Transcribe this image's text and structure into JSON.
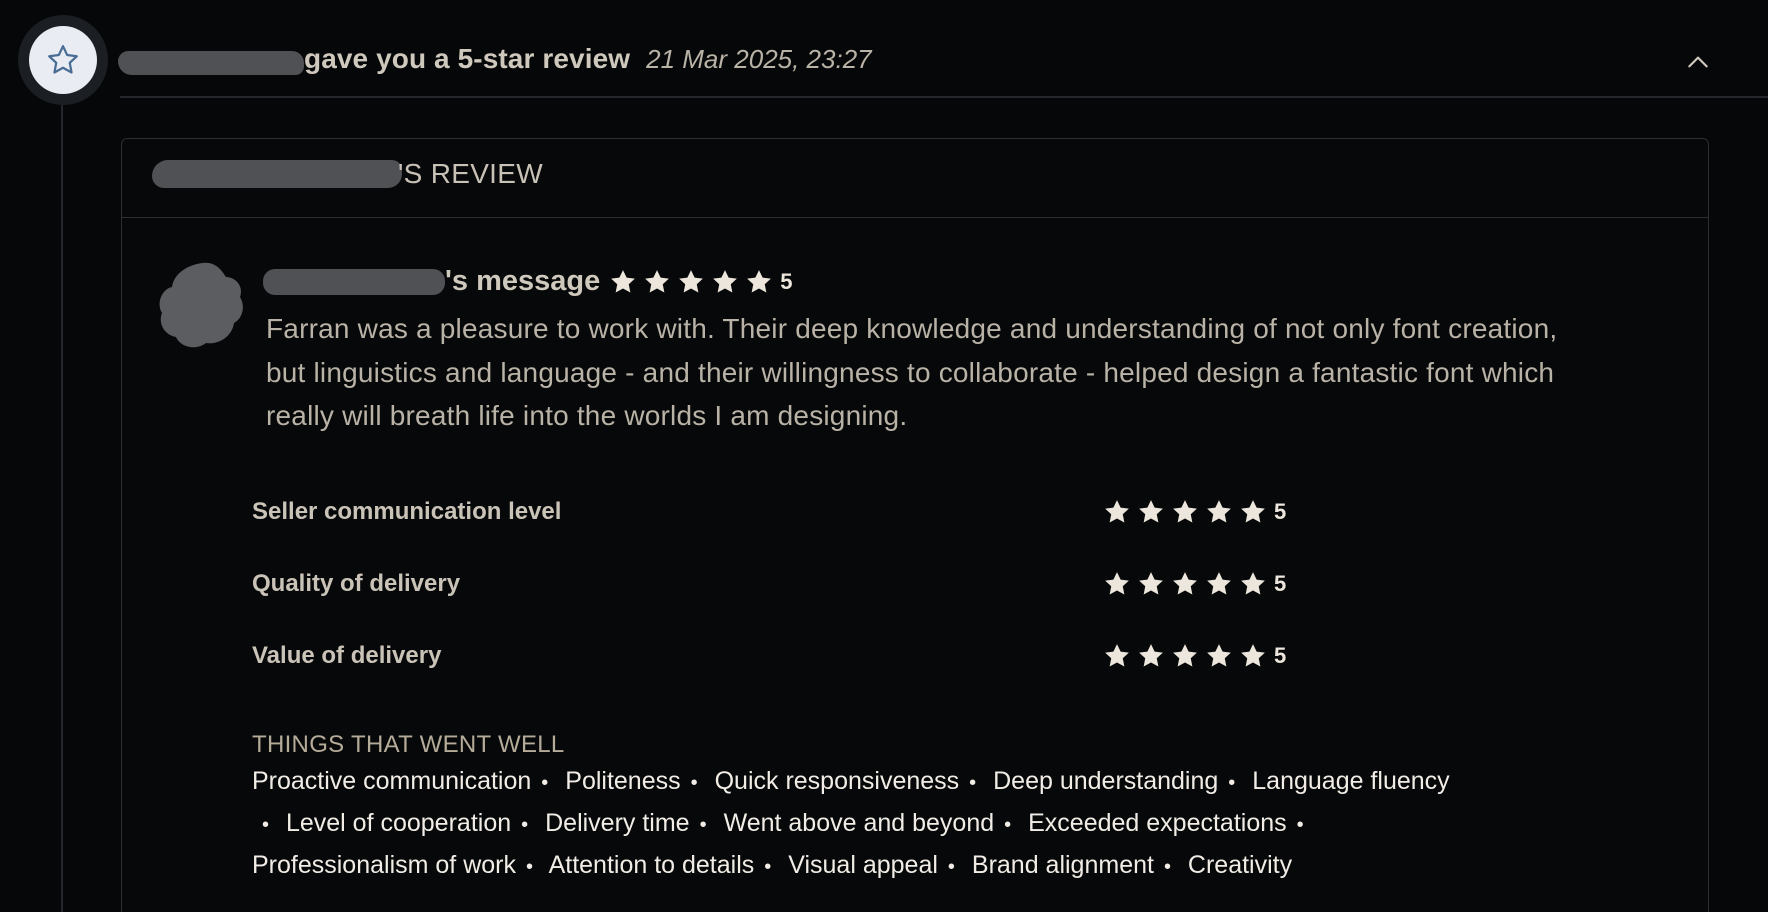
{
  "event": {
    "title": "gave you a 5-star review",
    "timestamp": "21 Mar 2025, 23:27",
    "badge_icon": "star-outline-icon",
    "collapse_icon": "chevron-up-icon"
  },
  "card": {
    "title_suffix": "'S REVIEW"
  },
  "message": {
    "label": "'s message",
    "rating": "5",
    "text": "Farran was a pleasure to work with. Their deep knowledge and understanding of not only font creation, but linguistics and language - and their willingness to collaborate - helped design a fantastic font which really will breath life into the worlds I am designing."
  },
  "ratings": [
    {
      "label": "Seller communication level",
      "value": "5"
    },
    {
      "label": "Quality of delivery",
      "value": "5"
    },
    {
      "label": "Value of delivery",
      "value": "5"
    }
  ],
  "went_well": {
    "title": "THINGS THAT WENT WELL",
    "tags": [
      "Proactive communication",
      "Politeness",
      "Quick responsiveness",
      "Deep understanding",
      "Language fluency",
      "Level of cooperation",
      "Delivery time",
      "Went above and beyond",
      "Exceeded expectations",
      "Professionalism of work",
      "Attention to details",
      "Visual appeal",
      "Brand alignment",
      "Creativity"
    ]
  },
  "colors": {
    "background": "#060708",
    "star": "#ece6dc",
    "badge_bg": "#e9edf3",
    "badge_icon": "#4a6d96"
  }
}
